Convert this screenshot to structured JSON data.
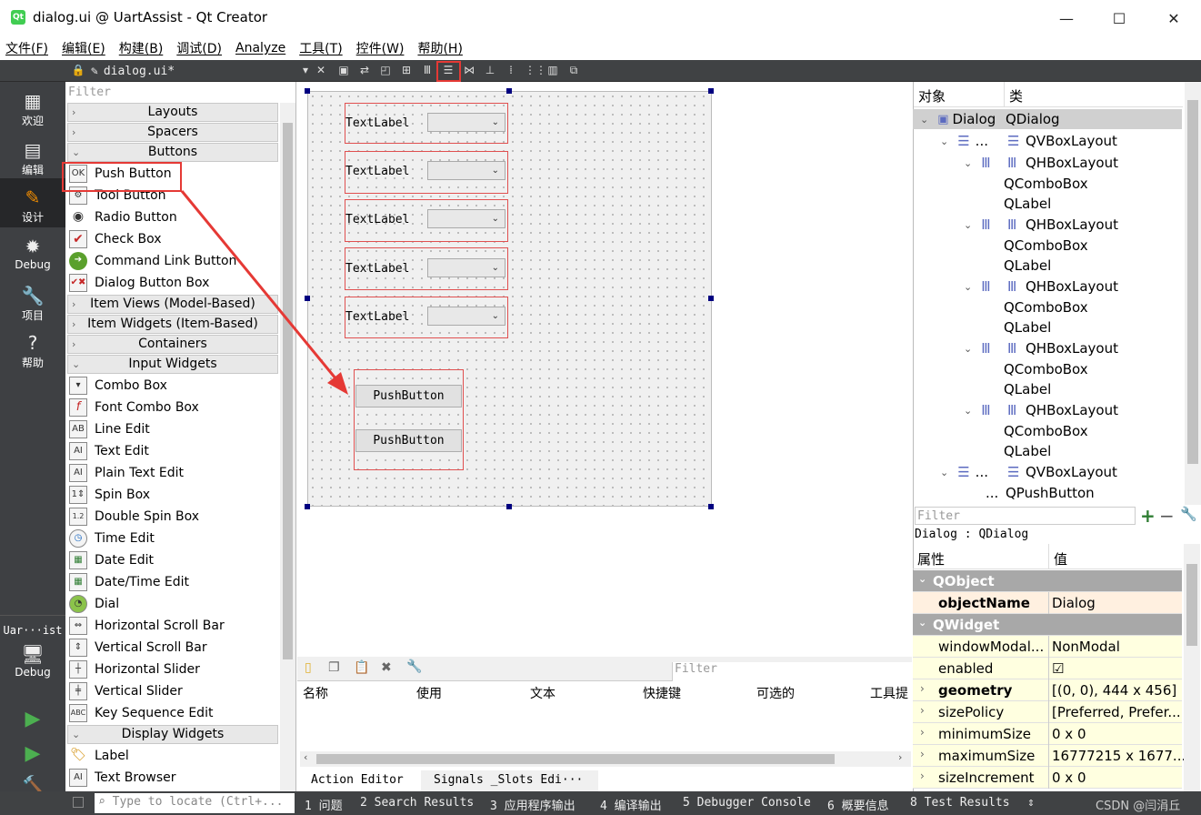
{
  "window": {
    "title": "dialog.ui @ UartAssist - Qt Creator",
    "app_icon": "Qt",
    "minimize": "—",
    "maximize": "☐",
    "close": "✕"
  },
  "menus": [
    "文件(F)",
    "编辑(E)",
    "构建(B)",
    "调试(D)",
    "Analyze",
    "工具(T)",
    "控件(W)",
    "帮助(H)"
  ],
  "editor_tab": {
    "name": "dialog.ui*",
    "close": "✕"
  },
  "modes": [
    {
      "label": "欢迎",
      "icon": "▦"
    },
    {
      "label": "编辑",
      "icon": "▤"
    },
    {
      "label": "设计",
      "icon": "✎"
    },
    {
      "label": "Debug",
      "icon": "✹"
    },
    {
      "label": "项目",
      "icon": "🔧"
    },
    {
      "label": "帮助",
      "icon": "?"
    }
  ],
  "kit": {
    "name": "Uar···ist",
    "mode": "Debug"
  },
  "widget_box": {
    "filter": "Filter",
    "categories": {
      "layouts": "Layouts",
      "spacers": "Spacers",
      "buttons": "Buttons",
      "item_views": "Item Views (Model-Based)",
      "item_widgets": "Item Widgets (Item-Based)",
      "containers": "Containers",
      "input_widgets": "Input Widgets",
      "display_widgets": "Display Widgets"
    },
    "buttons": [
      "Push Button",
      "Tool Button",
      "Radio Button",
      "Check Box",
      "Command Link Button",
      "Dialog Button Box"
    ],
    "inputs": [
      "Combo Box",
      "Font Combo Box",
      "Line Edit",
      "Text Edit",
      "Plain Text Edit",
      "Spin Box",
      "Double Spin Box",
      "Time Edit",
      "Date Edit",
      "Date/Time Edit",
      "Dial",
      "Horizontal Scroll Bar",
      "Vertical Scroll Bar",
      "Horizontal Slider",
      "Vertical Slider",
      "Key Sequence Edit"
    ],
    "display": [
      "Label",
      "Text Browser"
    ]
  },
  "form": {
    "labels": [
      "TextLabel",
      "TextLabel",
      "TextLabel",
      "TextLabel",
      "TextLabel"
    ],
    "buttons": [
      "PushButton",
      "PushButton"
    ]
  },
  "action_editor": {
    "filter": "Filter",
    "columns": [
      "名称",
      "使用",
      "文本",
      "快捷键",
      "可选的",
      "工具提"
    ],
    "tabs": [
      "Action Editor",
      "Signals _Slots Edi···"
    ]
  },
  "object_inspector": {
    "headers": [
      "对象",
      "类"
    ],
    "rows": [
      {
        "obj": "Dialog",
        "cls": "QDialog"
      },
      {
        "obj": "...",
        "cls": "QVBoxLayout"
      },
      {
        "obj": "",
        "cls": "QHBoxLayout"
      },
      {
        "obj": "",
        "cls": "QComboBox"
      },
      {
        "obj": "",
        "cls": "QLabel"
      },
      {
        "obj": "",
        "cls": "QHBoxLayout"
      },
      {
        "obj": "",
        "cls": "QComboBox"
      },
      {
        "obj": "",
        "cls": "QLabel"
      },
      {
        "obj": "",
        "cls": "QHBoxLayout"
      },
      {
        "obj": "",
        "cls": "QComboBox"
      },
      {
        "obj": "",
        "cls": "QLabel"
      },
      {
        "obj": "",
        "cls": "QHBoxLayout"
      },
      {
        "obj": "",
        "cls": "QComboBox"
      },
      {
        "obj": "",
        "cls": "QLabel"
      },
      {
        "obj": "",
        "cls": "QHBoxLayout"
      },
      {
        "obj": "",
        "cls": "QComboBox"
      },
      {
        "obj": "",
        "cls": "QLabel"
      },
      {
        "obj": "...",
        "cls": "QVBoxLayout"
      },
      {
        "obj": "...",
        "cls": "QPushButton"
      }
    ]
  },
  "property_editor": {
    "filter": "Filter",
    "context": "Dialog : QDialog",
    "headers": [
      "属性",
      "值"
    ],
    "groups": [
      "QObject",
      "QWidget"
    ],
    "props": [
      {
        "name": "objectName",
        "value": "Dialog"
      },
      {
        "name": "windowModal...",
        "value": "NonModal"
      },
      {
        "name": "enabled",
        "value": "☑"
      },
      {
        "name": "geometry",
        "value": "[(0, 0), 444 x 456]"
      },
      {
        "name": "sizePolicy",
        "value": "[Preferred, Prefer..."
      },
      {
        "name": "minimumSize",
        "value": "0 x 0"
      },
      {
        "name": "maximumSize",
        "value": "16777215 x 1677..."
      },
      {
        "name": "sizeIncrement",
        "value": "0 x 0"
      }
    ]
  },
  "status": {
    "locate_placeholder": "Type to locate (Ctrl+...",
    "items": [
      "1 问题",
      "2 Search Results",
      "3 应用程序输出",
      "4 编译输出",
      "5 Debugger Console",
      "6 概要信息",
      "8 Test Results"
    ],
    "watermark": "CSDN @闫涓丘"
  },
  "colors": {
    "accent_red": "#e53935",
    "sidebar": "#3e4043",
    "layout_red": "#e05050"
  }
}
